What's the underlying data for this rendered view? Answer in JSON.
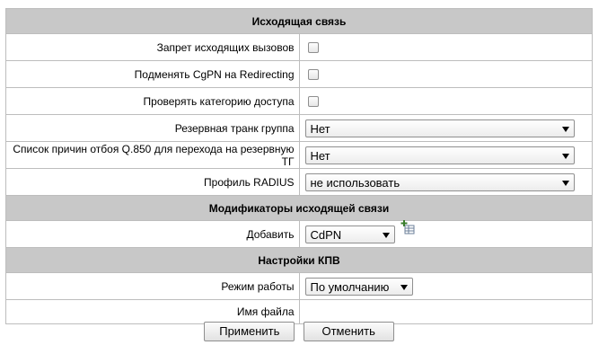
{
  "sections": {
    "outgoing": "Исходящая связь",
    "modifiers": "Модификаторы исходящей связи",
    "kpv": "Настройки КПВ"
  },
  "outgoing": {
    "bar_outgoing_label": "Запрет исходящих вызовов",
    "bar_outgoing_checked": false,
    "replace_cgpn_label": "Подменять CgPN на Redirecting",
    "replace_cgpn_checked": false,
    "check_access_label": "Проверять категорию доступа",
    "check_access_checked": false,
    "reserve_trunk_label": "Резервная транк группа",
    "reserve_trunk_value": "Нет",
    "q850_label": "Список причин отбоя Q.850 для перехода на резервную ТГ",
    "q850_value": "Нет",
    "radius_label": "Профиль RADIUS",
    "radius_value": "не использовать"
  },
  "modifiers": {
    "add_label": "Добавить",
    "add_value": "CdPN",
    "add_icon": "add-table-icon"
  },
  "kpv": {
    "mode_label": "Режим работы",
    "mode_value": "По умолчанию",
    "filename_label": "Имя файла",
    "filename_value": ""
  },
  "buttons": {
    "apply": "Применить",
    "cancel": "Отменить"
  },
  "colors": {
    "section_bg": "#c8c8c8",
    "border": "#bdbdbd"
  }
}
